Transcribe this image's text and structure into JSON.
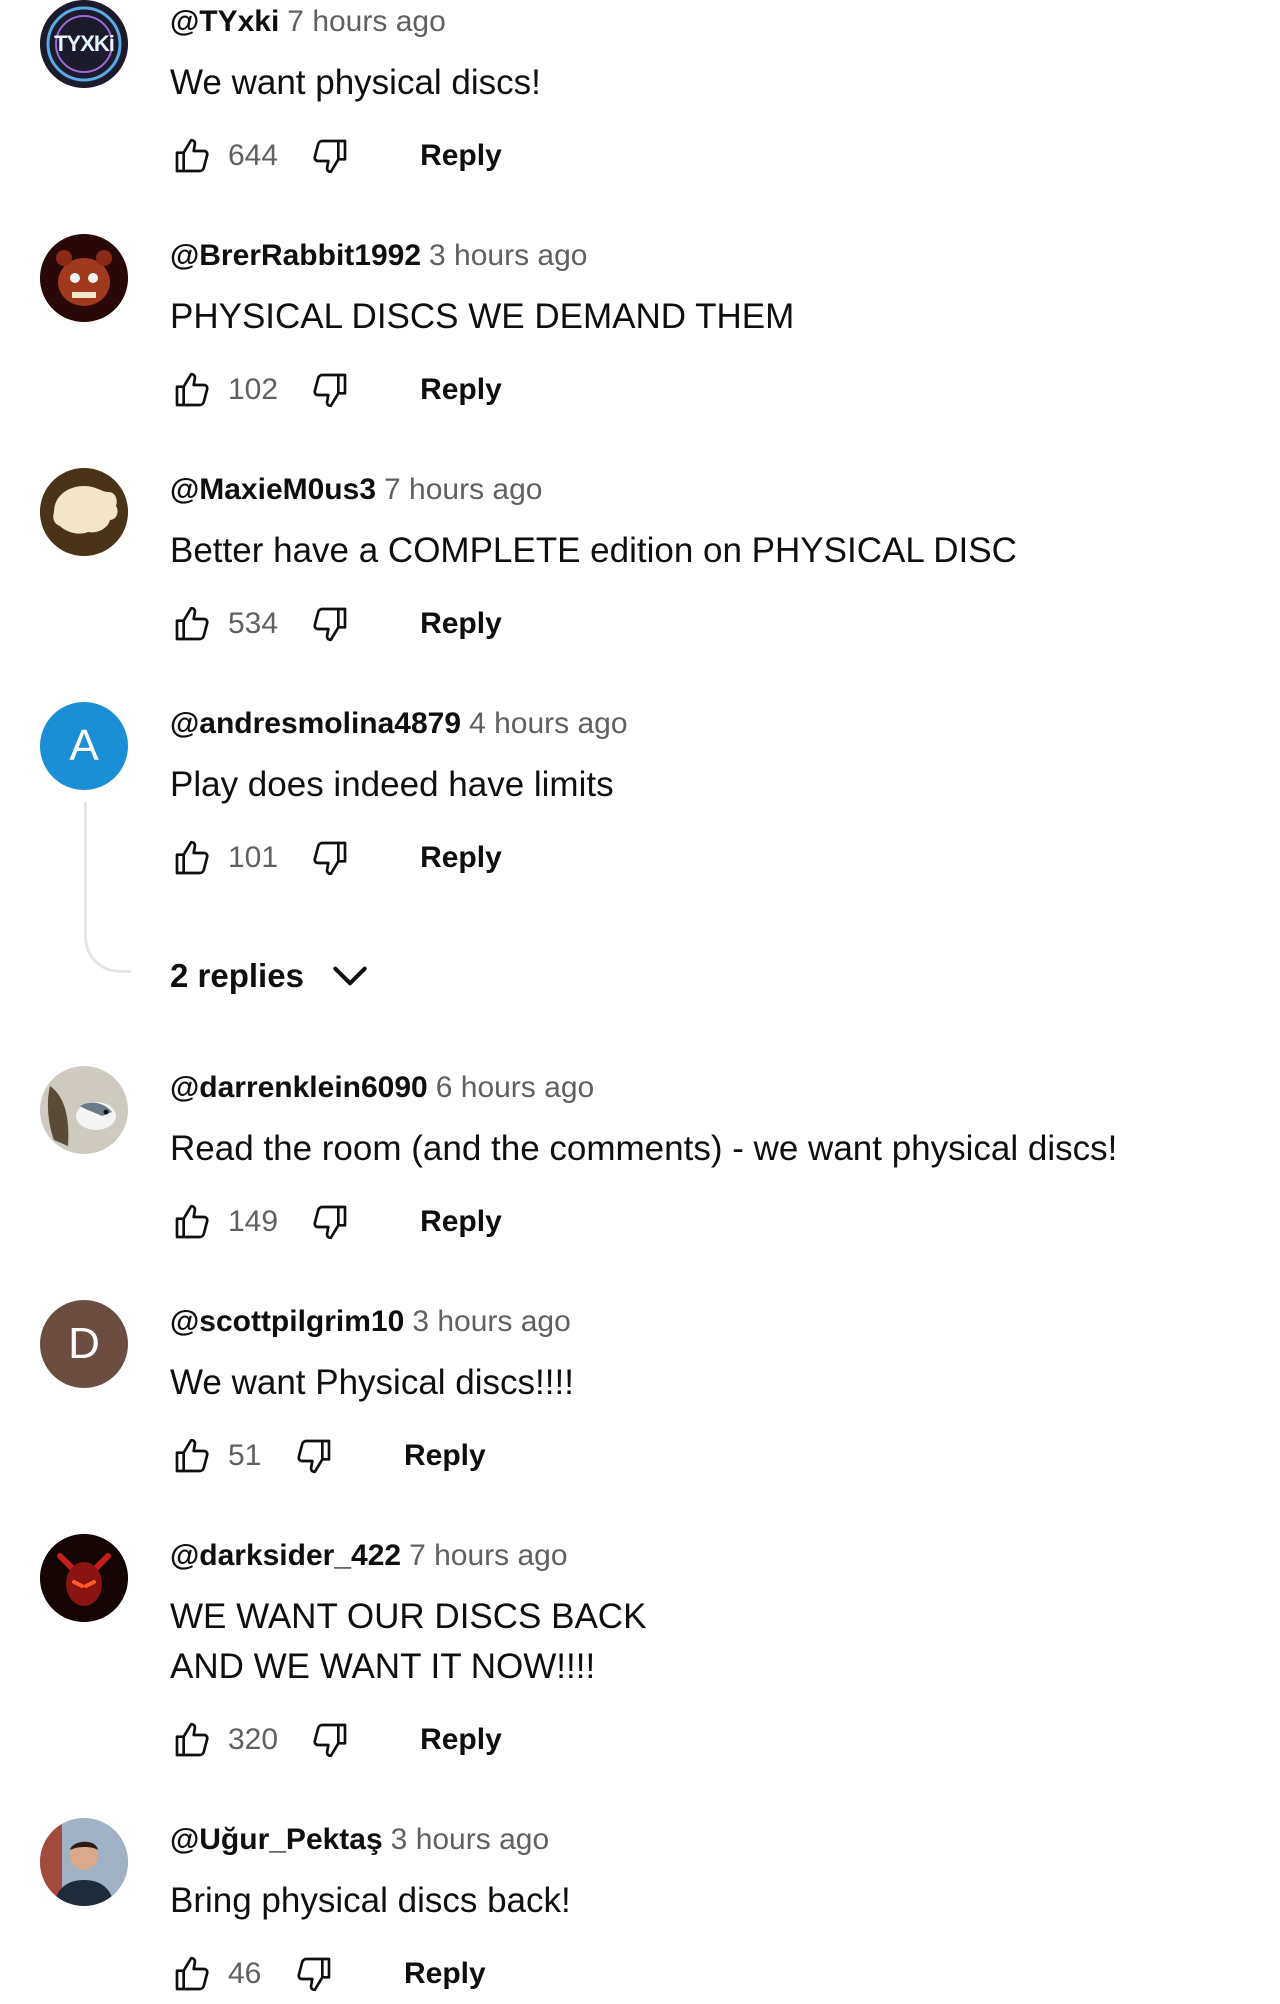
{
  "comments": [
    {
      "author": "@TYxki",
      "time": "7 hours ago",
      "text": "We want physical discs!",
      "likes": "644",
      "reply_label": "Reply",
      "avatar_text": "TYXKi"
    },
    {
      "author": "@BrerRabbit1992",
      "time": "3 hours ago",
      "text": "PHYSICAL DISCS WE DEMAND THEM",
      "likes": "102",
      "reply_label": "Reply"
    },
    {
      "author": "@MaxieM0us3",
      "time": "7 hours ago",
      "text": "Better have a COMPLETE edition on PHYSICAL DISC",
      "likes": "534",
      "reply_label": "Reply"
    },
    {
      "author": "@andresmolina4879",
      "time": "4 hours ago",
      "text": "Play does indeed have limits",
      "likes": "101",
      "reply_label": "Reply",
      "avatar_letter": "A",
      "avatar_color": "#1a8fd6",
      "replies_label": "2 replies"
    },
    {
      "author": "@darrenklein6090",
      "time": "6 hours ago",
      "text": "Read the room (and the comments) - we want physical discs!",
      "likes": "149",
      "reply_label": "Reply"
    },
    {
      "author": "@scottpilgrim10",
      "time": "3 hours ago",
      "text": "We want Physical discs!!!!",
      "likes": "51",
      "reply_label": "Reply",
      "avatar_letter": "D",
      "avatar_color": "#6d4c41"
    },
    {
      "author": "@darksider_422",
      "time": "7 hours ago",
      "text": "WE WANT OUR DISCS BACK\nAND WE WANT IT NOW!!!!",
      "likes": "320",
      "reply_label": "Reply"
    },
    {
      "author": "@Uğur_Pektaş",
      "time": "3 hours ago",
      "text": "Bring physical discs back!",
      "likes": "46",
      "reply_label": "Reply"
    }
  ],
  "icons": {
    "like": "thumbs-up-icon",
    "dislike": "thumbs-down-icon",
    "expand": "chevron-down-icon"
  },
  "colors": {
    "text": "#0f0f0f",
    "secondary": "#606060",
    "avatar_a": "#1a8fd6",
    "avatar_d": "#6d4c41"
  }
}
